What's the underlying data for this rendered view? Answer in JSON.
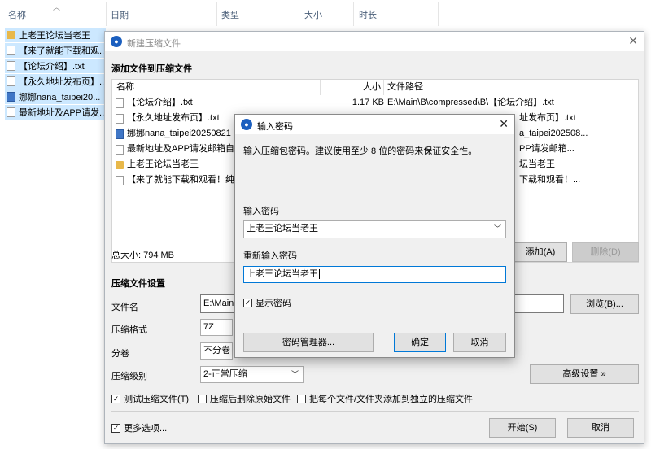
{
  "explorer": {
    "columns": [
      "名称",
      "日期",
      "类型",
      "大小",
      "时长"
    ],
    "files": [
      {
        "name": "上老王论坛当老王",
        "icon": "folder-icon"
      },
      {
        "name": "【来了就能下载和观...",
        "icon": "document-icon"
      },
      {
        "name": "【论坛介绍】.txt",
        "icon": "document-icon"
      },
      {
        "name": "【永久地址发布页】...",
        "icon": "document-icon"
      },
      {
        "name": "娜娜nana_taipei20...",
        "icon": "image-icon"
      },
      {
        "name": "最新地址及APP请发...",
        "icon": "document-icon"
      }
    ]
  },
  "compress_dialog": {
    "title": "新建压缩文件",
    "add_section": "添加文件到压缩文件",
    "table": {
      "col_name": "名称",
      "col_size": "大小",
      "col_path": "文件路径",
      "rows": [
        {
          "icon": "document-icon",
          "name": "【论坛介绍】.txt",
          "size": "1.17 KB",
          "path": "E:\\Main\\B\\compressed\\B\\【论坛介绍】.txt"
        },
        {
          "icon": "document-icon",
          "name": "【永久地址发布页】.txt",
          "size": "",
          "path": "址发布页】.txt"
        },
        {
          "icon": "image-icon",
          "name": "娜娜nana_taipei20250821「",
          "size": "",
          "path": "a_taipei202508..."
        },
        {
          "icon": "document-icon",
          "name": "最新地址及APP请发邮箱自动",
          "size": "",
          "path": "PP请发邮箱..."
        },
        {
          "icon": "folder-icon",
          "name": "上老王论坛当老王",
          "size": "",
          "path": "坛当老王"
        },
        {
          "icon": "document-icon",
          "name": "【来了就能下载和观看！纯免",
          "size": "",
          "path": "下载和观看！..."
        }
      ]
    },
    "total_size": "总大小: 794 MB",
    "add_button": "添加(A)",
    "delete_button": "删除(D)",
    "settings_section": "压缩文件设置",
    "filename_label": "文件名",
    "filename_value": "E:\\Main\\",
    "browse_button": "浏览(B)...",
    "format_label": "压缩格式",
    "format_value": "7Z",
    "split_label": "分卷",
    "split_value": "不分卷",
    "level_label": "压缩级别",
    "level_value": "2-正常压缩",
    "advanced_button": "高级设置 »",
    "test_checkbox": "测试压缩文件(T)",
    "delete_after_checkbox": "压缩后删除原始文件",
    "separate_checkbox": "把每个文件/文件夹添加到独立的压缩文件",
    "more_options": "更多选项...",
    "start_button": "开始(S)",
    "cancel_button": "取消"
  },
  "password_dialog": {
    "title": "输入密码",
    "description": "输入压缩包密码。建议使用至少 8 位的密码来保证安全性。",
    "enter_label": "输入密码",
    "enter_value": "上老王论坛当老王",
    "reenter_label": "重新输入密码",
    "reenter_value": "上老王论坛当老王",
    "show_password": "显示密码",
    "manager_button": "密码管理器...",
    "ok_button": "确定",
    "cancel_button": "取消"
  },
  "colors": {
    "selection": "#cce8ff",
    "accent": "#0078d7",
    "dialog_bg": "#f0f0f0"
  }
}
